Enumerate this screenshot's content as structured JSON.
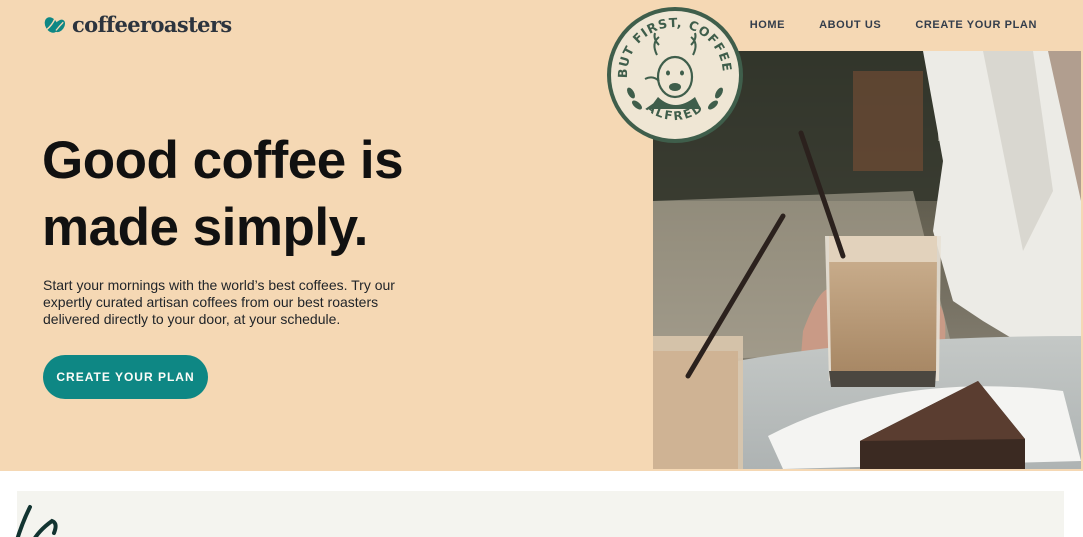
{
  "brand": {
    "name": "coffeeroasters",
    "icon": "coffee-bean-icon",
    "color": "#2c343e"
  },
  "nav": {
    "items": [
      "HOME",
      "ABOUT US",
      "CREATE YOUR PLAN"
    ]
  },
  "hero": {
    "title_line1": "Good coffee is",
    "title_line2": "made simply.",
    "body": "Start your mornings with the world’s best coffees. Try our expertly curated artisan coffees from our best roasters delivered directly to your door, at your schedule.",
    "cta_label": "CREATE YOUR PLAN",
    "photo": "iced-coffee-and-brownie-photo"
  },
  "badge": {
    "top_text": "BUT FIRST, COFFEE.",
    "bottom_text": "ALFRED"
  },
  "colors": {
    "hero_bg": "#f5d8b4",
    "accent": "#0e8784",
    "dark": "#2c343e",
    "badge_green": "#3f5e4b"
  }
}
